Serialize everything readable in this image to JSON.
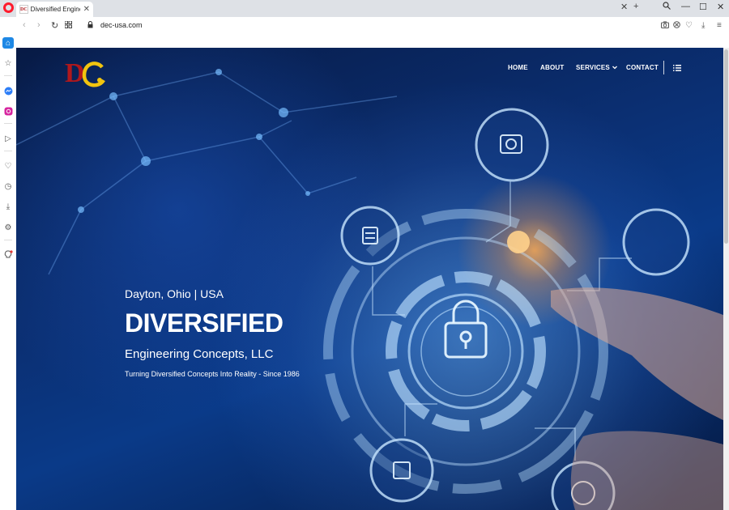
{
  "browser": {
    "tab_title": "Diversified Engineering Concepts",
    "favicon_text": "DC",
    "url": "dec-usa.com"
  },
  "site": {
    "logo_text": "DC",
    "nav": [
      {
        "label": "HOME"
      },
      {
        "label": "ABOUT"
      },
      {
        "label": "SERVICES"
      },
      {
        "label": "CONTACT"
      }
    ],
    "hero": {
      "kicker": "Dayton, Ohio | USA",
      "headline": "DIVERSIFIED",
      "subhead": "Engineering Concepts, LLC",
      "tagline": "Turning Diversified Concepts Into Reality - Since 1986"
    }
  },
  "colors": {
    "accent": "#1e88e5",
    "hero_dark": "#071a45",
    "hero_glow": "#ffaa50",
    "opera_red": "#ff1b2d"
  }
}
